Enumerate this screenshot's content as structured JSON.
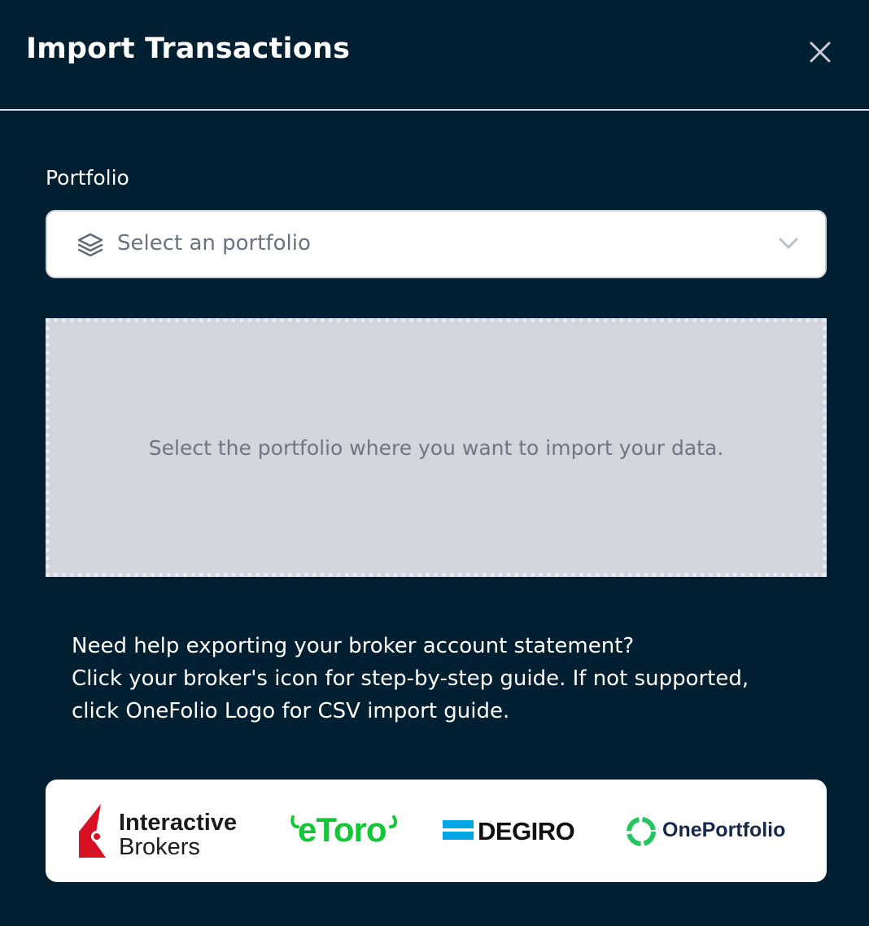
{
  "dialog": {
    "title": "Import Transactions"
  },
  "portfolio": {
    "label": "Portfolio",
    "placeholder": "Select an portfolio"
  },
  "dropzone": {
    "message": "Select the portfolio where you want to import your data."
  },
  "help": {
    "line1": "Need help exporting your broker account statement?",
    "line2": "Click your broker's icon for step-by-step guide. If not supported,",
    "line3": "click OneFolio Logo for CSV import guide."
  },
  "brokers": {
    "interactive_brokers": {
      "line1": "Interactive",
      "line2": "Brokers"
    },
    "etoro": {
      "label": "eToro"
    },
    "degiro": {
      "label": "DEGIRO"
    },
    "oneportfolio": {
      "label": "OnePortfolio"
    }
  },
  "colors": {
    "background": "#032033",
    "etoro_green": "#13c636",
    "ib_red": "#d81222",
    "degiro_blue": "#00a6e6",
    "oneportfolio_green": "#22c55e"
  }
}
